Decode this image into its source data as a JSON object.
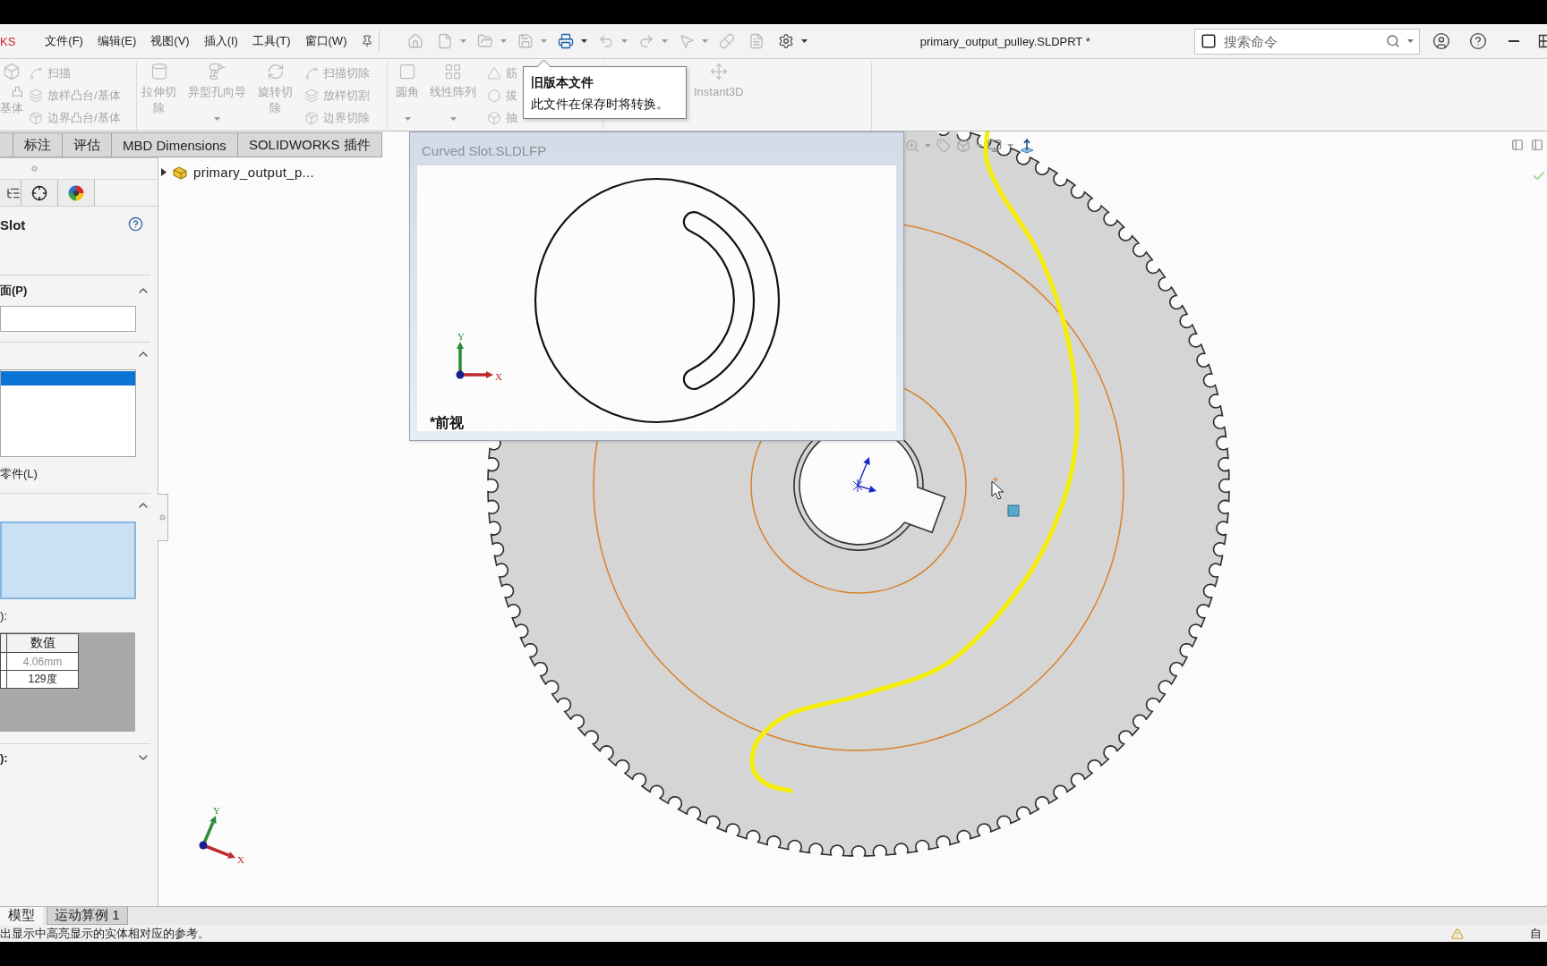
{
  "menubar": {
    "logo": "KS",
    "menus": [
      "文件(F)",
      "编辑(E)",
      "视图(V)",
      "插入(I)",
      "工具(T)",
      "窗口(W)"
    ],
    "title": "primary_output_pulley.SLDPRT *",
    "search": {
      "placeholder": "搜索命令"
    }
  },
  "quick_access": [
    {
      "disabled": true,
      "dropdown": false
    },
    {
      "disabled": true,
      "dropdown": true
    },
    {
      "disabled": true,
      "dropdown": true
    },
    {
      "disabled": true,
      "dropdown": true
    },
    {
      "disabled": false,
      "dropdown": true
    },
    {
      "disabled": true,
      "dropdown": true
    },
    {
      "disabled": true,
      "dropdown": true
    },
    {
      "disabled": true,
      "dropdown": true
    },
    {
      "disabled": true,
      "dropdown": false
    },
    {
      "disabled": true,
      "dropdown": false
    },
    {
      "disabled": false,
      "dropdown": true
    }
  ],
  "ribbon": {
    "groups": [
      {
        "items": [
          {
            "kind": "large",
            "label": "凸基体",
            "disabled": true,
            "dropdown": false
          },
          {
            "kind": "small",
            "label": "扫描",
            "disabled": true
          },
          {
            "kind": "small",
            "label": "放样凸台/基体",
            "disabled": true
          },
          {
            "kind": "small",
            "label": "边界凸台/基体",
            "disabled": true
          }
        ]
      },
      {
        "items": [
          {
            "kind": "large",
            "label": "拉伸切除",
            "disabled": true,
            "dropdown": false
          },
          {
            "kind": "large",
            "label": "异型孔向导",
            "disabled": true,
            "dropdown": true
          },
          {
            "kind": "large",
            "label": "旋转切除",
            "disabled": true,
            "dropdown": false
          },
          {
            "kind": "small",
            "label": "扫描切除",
            "disabled": true
          },
          {
            "kind": "small",
            "label": "放样切割",
            "disabled": true
          },
          {
            "kind": "small",
            "label": "边界切除",
            "disabled": true
          }
        ]
      },
      {
        "items": [
          {
            "kind": "large",
            "label": "圆角",
            "disabled": true,
            "dropdown": true
          },
          {
            "kind": "large",
            "label": "线性阵列",
            "disabled": true,
            "dropdown": true
          },
          {
            "kind": "small",
            "label": "筋",
            "disabled": true
          },
          {
            "kind": "small",
            "label": "拔",
            "disabled": true
          },
          {
            "kind": "small",
            "label": "抽",
            "disabled": true
          }
        ]
      },
      {
        "items": [
          {
            "kind": "large",
            "label": "Instant3D",
            "disabled": true,
            "dropdown": false
          }
        ]
      }
    ]
  },
  "tooltip": {
    "title": "旧版本文件",
    "text": "此文件在保存时将转换。"
  },
  "tabs": [
    {
      "selected": false
    },
    {
      "label": "标注",
      "selected": false
    },
    {
      "label": "评估",
      "selected": false
    },
    {
      "label": "MBD Dimensions",
      "selected": false
    },
    {
      "label": "SOLIDWORKS 插件",
      "selected": false
    }
  ],
  "property_manager": {
    "title": "Slot",
    "sections": [
      {
        "kind": "field",
        "title": "面(P)",
        "expanded": true
      },
      {
        "kind": "list",
        "expanded": true,
        "rows": [
          {
            "selected": true
          }
        ],
        "note": "零件(L)"
      },
      {
        "kind": "parameters",
        "expanded": true,
        "label": "):",
        "columns": [
          "数值"
        ],
        "rows": [
          {
            "value": "4.06mm",
            "disabled": true
          },
          {
            "value": "129度",
            "disabled": false
          }
        ]
      },
      {
        "kind": "header",
        "title": "):",
        "expanded": false
      }
    ]
  },
  "feature_tree": {
    "label": "primary_output_p...",
    "expanded": false
  },
  "preview": {
    "title": "Curved Slot.SLDLFP",
    "view_label": "*前视",
    "axes": {
      "x": "X",
      "y": "Y"
    }
  },
  "viewport": {
    "axes": {
      "x": "X",
      "y": "Y"
    }
  },
  "bottom_tabs": [
    {
      "label": "模型",
      "selected": true
    },
    {
      "label": "运动算例 1",
      "selected": false
    }
  ],
  "status_bar": {
    "message": "出显示中高亮显示的实体相对应的参考。",
    "right_text": "自"
  }
}
